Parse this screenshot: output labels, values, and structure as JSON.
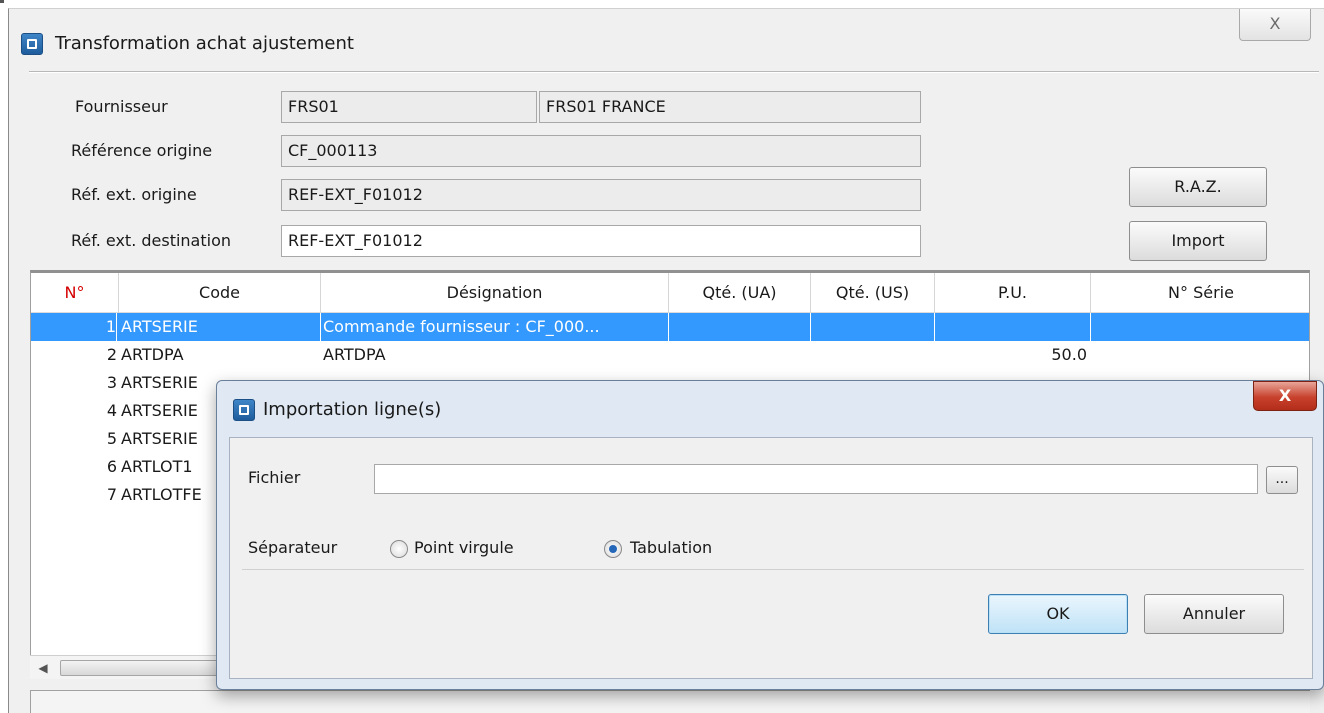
{
  "window": {
    "title": "Transformation achat ajustement",
    "close_label": "X"
  },
  "form": {
    "fournisseur_label": "Fournisseur",
    "fournisseur_code": "FRS01",
    "fournisseur_name": "FRS01 FRANCE",
    "ref_origine_label": "Référence origine",
    "ref_origine_value": "CF_000113",
    "ref_ext_origine_label": "Réf. ext. origine",
    "ref_ext_origine_value": "REF-EXT_F01012",
    "ref_ext_dest_label": "Réf. ext. destination",
    "ref_ext_dest_value": "REF-EXT_F01012"
  },
  "buttons": {
    "raz": "R.A.Z.",
    "import": "Import"
  },
  "grid": {
    "columns": [
      "N°",
      "Code",
      "Désignation",
      "Qté. (UA)",
      "Qté. (US)",
      "P.U.",
      "N° Série"
    ],
    "rows": [
      {
        "num": "1",
        "code": "ARTSERIE",
        "designation": "Commande fournisseur : CF_000...",
        "qte_ua": "",
        "qte_us": "",
        "pu": "",
        "serie": ""
      },
      {
        "num": "2",
        "code": "ARTDPA",
        "designation": "ARTDPA",
        "qte_ua": "",
        "qte_us": "",
        "pu": "50.0",
        "serie": ""
      },
      {
        "num": "3",
        "code": "ARTSERIE",
        "designation": "",
        "qte_ua": "",
        "qte_us": "",
        "pu": "",
        "serie": ""
      },
      {
        "num": "4",
        "code": "ARTSERIE",
        "designation": "",
        "qte_ua": "",
        "qte_us": "",
        "pu": "",
        "serie": ""
      },
      {
        "num": "5",
        "code": "ARTSERIE",
        "designation": "",
        "qte_ua": "",
        "qte_us": "",
        "pu": "",
        "serie": ""
      },
      {
        "num": "6",
        "code": "ARTLOT1",
        "designation": "",
        "qte_ua": "",
        "qte_us": "",
        "pu": "",
        "serie": ""
      },
      {
        "num": "7",
        "code": "ARTLOTFE",
        "designation": "",
        "qte_ua": "",
        "qte_us": "",
        "pu": "",
        "serie": ""
      }
    ],
    "selected_row": 1
  },
  "dialog": {
    "title": "Importation ligne(s)",
    "close_label": "X",
    "fichier_label": "Fichier",
    "fichier_value": "",
    "browse_label": "...",
    "separateur_label": "Séparateur",
    "radio_point_virgule": "Point virgule",
    "radio_tabulation": "Tabulation",
    "selected_separator": "Tabulation",
    "ok_label": "OK",
    "cancel_label": "Annuler"
  },
  "colors": {
    "selection": "#3399ff",
    "header_accent": "#d40000",
    "dialog_frame": "#dfe8f3",
    "close_red": "#c7412c"
  },
  "icons": [
    "app-icon",
    "close-icon",
    "scroll-left-icon"
  ]
}
